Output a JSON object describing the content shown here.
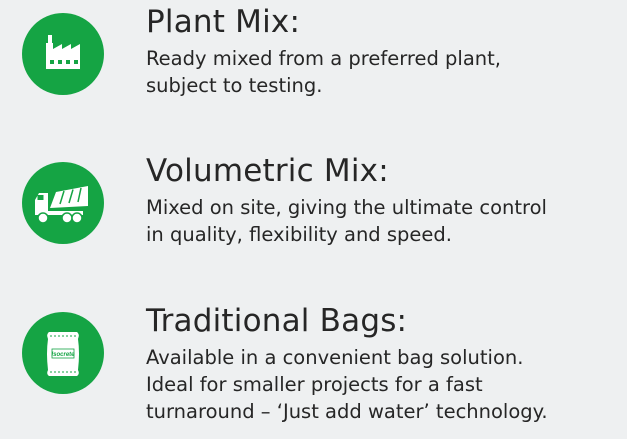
{
  "accent_color": "#15a444",
  "items": [
    {
      "icon": "factory-icon",
      "title": "Plant Mix:",
      "lines": [
        "Ready mixed from a preferred plant,",
        "subject to testing."
      ]
    },
    {
      "icon": "truck-icon",
      "title": "Volumetric Mix:",
      "lines": [
        "Mixed on site, giving the ultimate control",
        "in quality, flexibility and speed."
      ]
    },
    {
      "icon": "bag-icon",
      "bag_brand": "Isocrete",
      "title": "Traditional Bags:",
      "lines": [
        "Available in a convenient bag solution.",
        "Ideal for smaller projects for a fast",
        "turnaround – ‘Just add water’ technology."
      ]
    }
  ]
}
